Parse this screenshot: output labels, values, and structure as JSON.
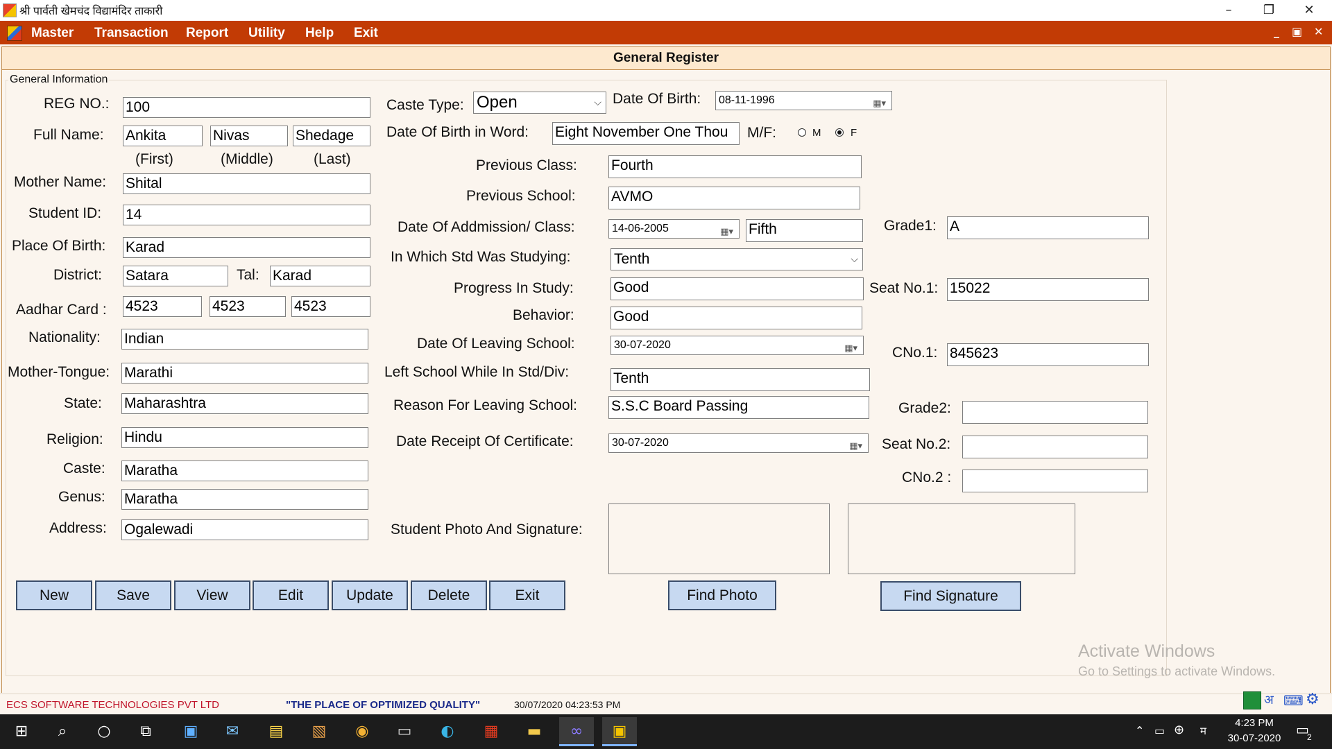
{
  "window": {
    "title": "श्री पार्वती खेमचंद विद्यामंदिर ताकारी",
    "minimize_icon": "–",
    "restore_icon": "❐",
    "close_icon": "✕"
  },
  "menu": {
    "items": [
      "Master",
      "Transaction",
      "Report",
      "Utility",
      "Help",
      "Exit"
    ],
    "mdi_controls": [
      "_",
      "▣",
      "✕"
    ]
  },
  "form": {
    "title": "General Register",
    "group_label": "General Information"
  },
  "left": {
    "reg_no_label": "REG NO.:",
    "reg_no": "100",
    "full_name_label": "Full Name:",
    "first": "Ankita",
    "middle": "Nivas",
    "last": "Shedage",
    "first_caption": "(First)",
    "middle_caption": "(Middle)",
    "last_caption": "(Last)",
    "mother_label": "Mother Name:",
    "mother": "Shital",
    "student_id_label": "Student ID:",
    "student_id": "14",
    "pob_label": "Place Of Birth:",
    "pob": "Karad",
    "district_label": "District:",
    "district": "Satara",
    "tal_label": "Tal:",
    "tal": "Karad",
    "aadhar_label": "Aadhar Card :",
    "aadhar1": "4523",
    "aadhar2": "4523",
    "aadhar3": "4523",
    "nationality_label": "Nationality:",
    "nationality": "Indian",
    "tongue_label": "Mother-Tongue:",
    "tongue": "Marathi",
    "state_label": "State:",
    "state": "Maharashtra",
    "religion_label": "Religion:",
    "religion": "Hindu",
    "caste_label": "Caste:",
    "caste": "Maratha",
    "genus_label": "Genus:",
    "genus": "Maratha",
    "address_label": "Address:",
    "address": "Ogalewadi"
  },
  "middle": {
    "caste_type_label": "Caste Type:",
    "caste_type": "Open",
    "dob_label": "Date Of Birth:",
    "dob": "08-11-1996",
    "dob_word_label": "Date Of Birth in Word:",
    "dob_word": "Eight November One Thou",
    "gender_label": "M/F:",
    "gender_m": "M",
    "gender_f": "F",
    "gender_selected": "F",
    "prev_class_label": "Previous Class:",
    "prev_class": "Fourth",
    "prev_school_label": "Previous School:",
    "prev_school": "AVMO",
    "admission_label": "Date Of Addmission/ Class:",
    "admission_date": "14-06-2005",
    "admission_class": "Fifth",
    "std_label": "In Which Std Was Studying:",
    "std": "Tenth",
    "progress_label": "Progress In Study:",
    "progress": "Good",
    "behavior_label": "Behavior:",
    "behavior": "Good",
    "leaving_date_label": "Date Of Leaving School:",
    "leaving_date": "30-07-2020",
    "left_std_label": "Left School While In Std/Div:",
    "left_std": "Tenth",
    "reason_label": "Reason For Leaving School:",
    "reason": "S.S.C Board Passing",
    "receipt_label": "Date Receipt Of Certificate:",
    "receipt_date": "30-07-2020",
    "photo_label": "Student Photo And Signature:"
  },
  "right": {
    "grade1_label": "Grade1:",
    "grade1": "A",
    "seat1_label": "Seat No.1:",
    "seat1": "15022",
    "cno1_label": "CNo.1:",
    "cno1": "845623",
    "grade2_label": "Grade2:",
    "grade2": "",
    "seat2_label": "Seat No.2:",
    "seat2": "",
    "cno2_label": "CNo.2 :",
    "cno2": ""
  },
  "buttons": {
    "new": "New",
    "save": "Save",
    "view": "View",
    "edit": "Edit",
    "update": "Update",
    "delete": "Delete",
    "exit": "Exit",
    "find_photo": "Find Photo",
    "find_signature": "Find Signature"
  },
  "status": {
    "company": "ECS SOFTWARE TECHNOLOGIES PVT LTD",
    "slogan": "\"THE PLACE OF OPTIMIZED QUALITY\"",
    "datetime": "30/07/2020 04:23:53 PM"
  },
  "watermark": {
    "line1": "Activate Windows",
    "line2": "Go to Settings to activate Windows."
  },
  "taskbar": {
    "time": "4:23 PM",
    "date": "30-07-2020",
    "lang": "म",
    "notif_count": "2"
  },
  "colors": {
    "menu_bg": "#c23b05",
    "header_bg": "#fde9cf",
    "form_bg": "#fbf5ee",
    "button_bg": "#c7d9f1",
    "company_text": "#c0142a",
    "slogan_text": "#1a2a8a"
  }
}
